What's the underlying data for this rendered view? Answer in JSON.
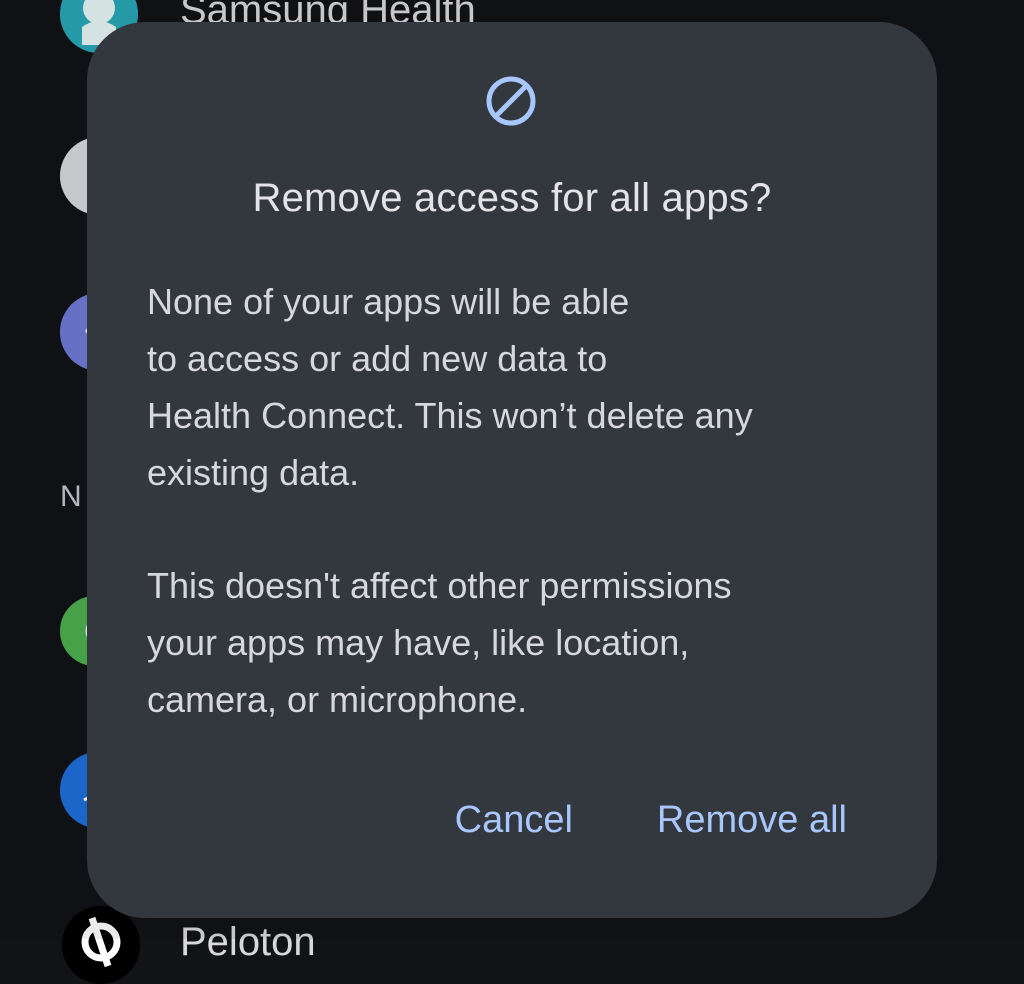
{
  "background": {
    "top_app_label": "Samsung Health",
    "bottom_app_label": "Peloton",
    "section_letter": "N",
    "icons": [
      {
        "name": "samsung-health-icon",
        "color": "#2aa7b8"
      },
      {
        "name": "app-icon-2",
        "color": "#cfd3d8"
      },
      {
        "name": "app-icon-3",
        "color": "#6d7bd6"
      },
      {
        "name": "app-icon-4",
        "color": "#4caf50"
      },
      {
        "name": "app-icon-5",
        "color": "#1e6fd9"
      },
      {
        "name": "peloton-icon",
        "color": "#000000"
      }
    ]
  },
  "dialog": {
    "icon": "block-icon",
    "title": "Remove access for all apps?",
    "body_1_lines": [
      "None of your apps will be able",
      "to access or add new data to",
      "Health Connect. This won’t delete any",
      "existing data."
    ],
    "body_2_lines": [
      "This doesn't affect other permissions",
      "your apps may have, like location,",
      "camera, or microphone."
    ],
    "cancel_label": "Cancel",
    "confirm_label": "Remove all"
  },
  "colors": {
    "dialog_bg": "#33373e",
    "accent": "#a9c7ff",
    "page_bg": "#121316"
  }
}
